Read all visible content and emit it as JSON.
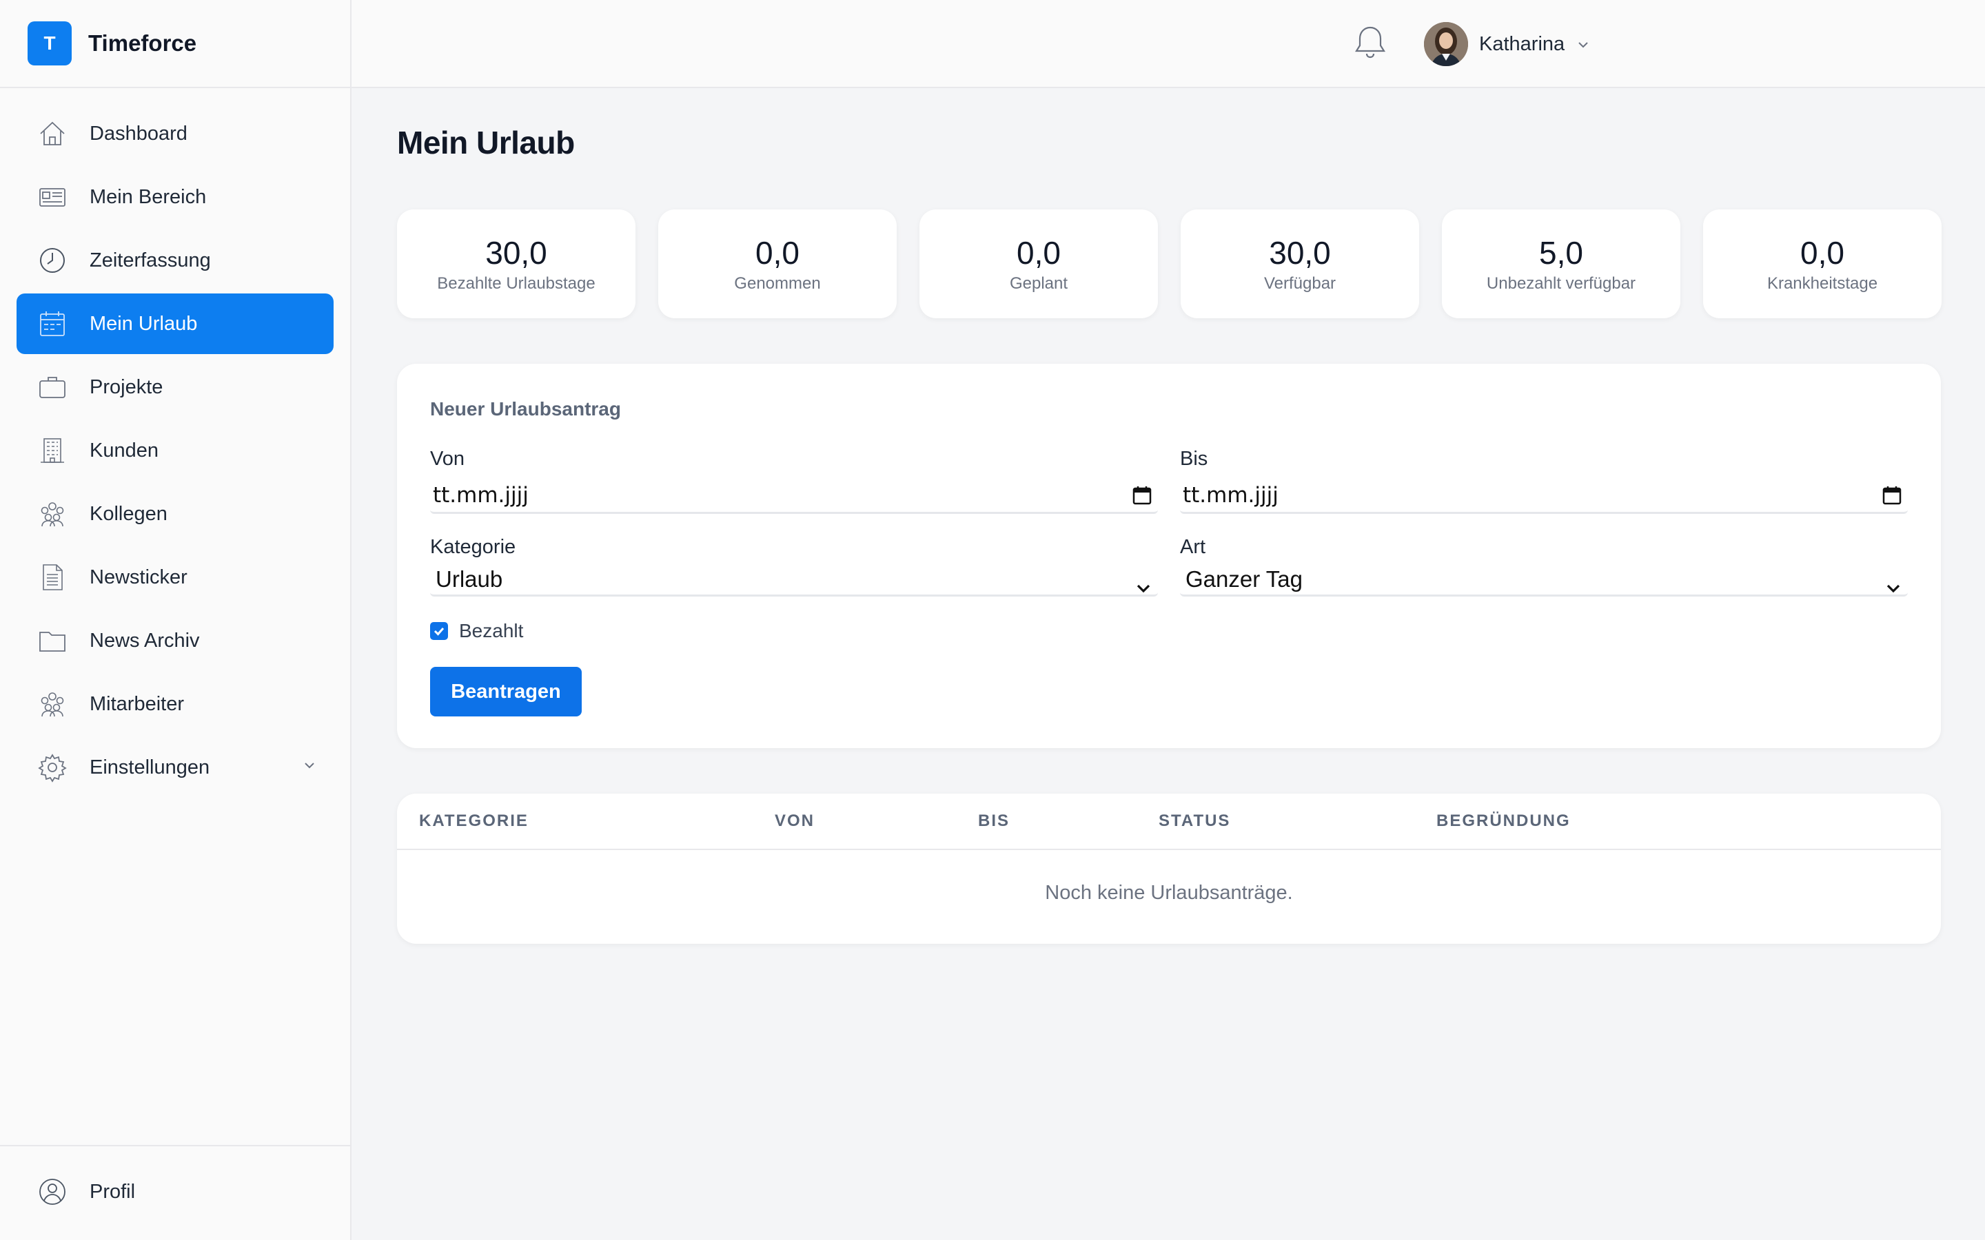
{
  "app": {
    "logo_letter": "T",
    "name": "Timeforce"
  },
  "sidebar": {
    "items": [
      {
        "label": "Dashboard",
        "icon": "home-icon"
      },
      {
        "label": "Mein Bereich",
        "icon": "id-card-icon"
      },
      {
        "label": "Zeiterfassung",
        "icon": "clock-icon"
      },
      {
        "label": "Mein Urlaub",
        "icon": "calendar-icon",
        "active": true
      },
      {
        "label": "Projekte",
        "icon": "briefcase-icon"
      },
      {
        "label": "Kunden",
        "icon": "building-icon"
      },
      {
        "label": "Kollegen",
        "icon": "group-icon"
      },
      {
        "label": "Newsticker",
        "icon": "document-icon"
      },
      {
        "label": "News Archiv",
        "icon": "folder-icon"
      },
      {
        "label": "Mitarbeiter",
        "icon": "group-icon"
      },
      {
        "label": "Einstellungen",
        "icon": "gear-icon"
      }
    ],
    "bottom": {
      "label": "Profil",
      "icon": "user-circle-icon"
    }
  },
  "header": {
    "user_name": "Katharina"
  },
  "page": {
    "title": "Mein Urlaub"
  },
  "stats": [
    {
      "value": "30,0",
      "label": "Bezahlte Urlaubstage"
    },
    {
      "value": "0,0",
      "label": "Genommen"
    },
    {
      "value": "0,0",
      "label": "Geplant"
    },
    {
      "value": "30,0",
      "label": "Verfügbar"
    },
    {
      "value": "5,0",
      "label": "Unbezahlt verfügbar"
    },
    {
      "value": "0,0",
      "label": "Krankheitstage"
    }
  ],
  "form": {
    "heading": "Neuer Urlaubsantrag",
    "from_label": "Von",
    "from_value": "tt.mm.jjjj",
    "to_label": "Bis",
    "to_value": "tt.mm.jjjj",
    "category_label": "Kategorie",
    "category_value": "Urlaub",
    "type_label": "Art",
    "type_value": "Ganzer Tag",
    "paid_label": "Bezahlt",
    "paid_checked": true,
    "submit_label": "Beantragen"
  },
  "table": {
    "headers": [
      "KATEGORIE",
      "VON",
      "BIS",
      "STATUS",
      "BEGRÜNDUNG"
    ],
    "empty_text": "Noch keine Urlaubsanträge."
  },
  "colors": {
    "accent": "#0d7ef0",
    "button": "#0d72e8"
  }
}
